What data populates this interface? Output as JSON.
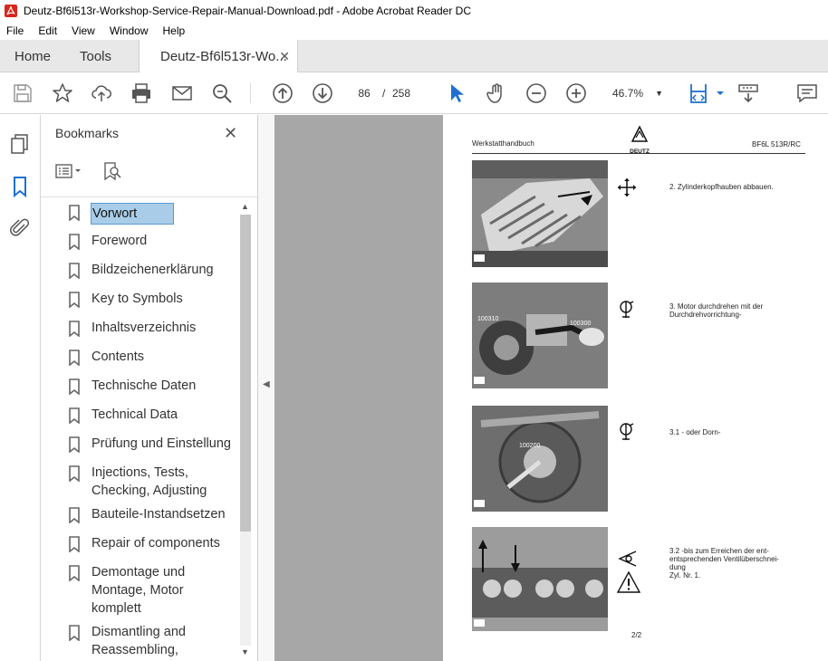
{
  "window": {
    "title": "Deutz-Bf6l513r-Workshop-Service-Repair-Manual-Download.pdf - Adobe Acrobat Reader DC"
  },
  "menu": [
    "File",
    "Edit",
    "View",
    "Window",
    "Help"
  ],
  "tabs": {
    "home": "Home",
    "tools": "Tools",
    "document": "Deutz-Bf6l513r-Wo...",
    "close": "✕"
  },
  "toolbar": {
    "icons": [
      "save-icon",
      "star-icon",
      "upload-icon",
      "print-icon",
      "mail-icon",
      "search-icon",
      "page-up-icon",
      "page-down-icon",
      "cursor-icon",
      "hand-icon",
      "zoom-out-icon",
      "zoom-in-icon",
      "fit-page-icon",
      "read-mode-icon",
      "comment-icon"
    ],
    "current_page": "86",
    "separator": "/",
    "total_pages": "258",
    "zoom": "46.7%"
  },
  "bookmarks": {
    "title": "Bookmarks",
    "close": "✕",
    "items": [
      {
        "label": "Vorwort",
        "selected": true
      },
      {
        "label": "Foreword"
      },
      {
        "label": "Bildzeichenerklärung"
      },
      {
        "label": "Key to Symbols"
      },
      {
        "label": "Inhaltsverzeichnis"
      },
      {
        "label": "Contents"
      },
      {
        "label": "Technische Daten"
      },
      {
        "label": "Technical Data"
      },
      {
        "label": "Prüfung und Einstellung"
      },
      {
        "label": "Injections, Tests,\nChecking, Adjusting"
      },
      {
        "label": "Bauteile-Instandsetzen"
      },
      {
        "label": "Repair of components"
      },
      {
        "label": "Demontage und\nMontage, Motor\nkomplett"
      },
      {
        "label": "Dismantling and\nReassembling,"
      }
    ]
  },
  "document": {
    "header_left": "Werkstatthandbuch",
    "header_right": "BF6L 513R/RC",
    "logo_text": "DEUTZ",
    "logo_sub": "KHD",
    "steps": [
      {
        "caption": "2. Zylinderkopfhauben abbauen.",
        "photo_tag": "4-3"
      },
      {
        "caption": "3. Motor durchdrehen mit der\nDurchdrehvorrichtung-",
        "photo_tag": "4-3",
        "labels": [
          "100310",
          "100300"
        ]
      },
      {
        "caption": "3.1 - oder Dorn-",
        "photo_tag": "4-4",
        "labels": [
          "100200"
        ]
      },
      {
        "caption": "3.2 -bis zum Erreichen der ent-\nentsprechenden Ventilüberschnei-\ndung\nZyl. Nr. 1.",
        "photo_tag": "4-4"
      }
    ],
    "page_number": "2/2"
  }
}
